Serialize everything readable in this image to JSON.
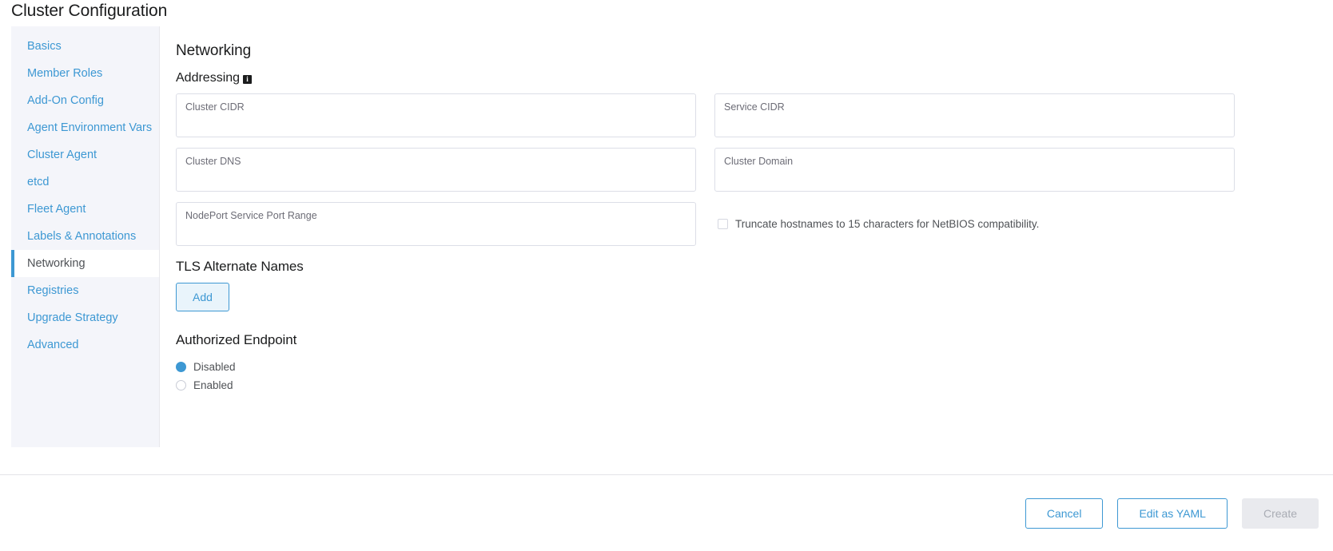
{
  "page_title": "Cluster Configuration",
  "sidebar": {
    "items": [
      {
        "label": "Basics",
        "active": false
      },
      {
        "label": "Member Roles",
        "active": false
      },
      {
        "label": "Add-On Config",
        "active": false
      },
      {
        "label": "Agent Environment Vars",
        "active": false
      },
      {
        "label": "Cluster Agent",
        "active": false
      },
      {
        "label": "etcd",
        "active": false
      },
      {
        "label": "Fleet Agent",
        "active": false
      },
      {
        "label": "Labels & Annotations",
        "active": false
      },
      {
        "label": "Networking",
        "active": true
      },
      {
        "label": "Registries",
        "active": false
      },
      {
        "label": "Upgrade Strategy",
        "active": false
      },
      {
        "label": "Advanced",
        "active": false
      }
    ]
  },
  "main": {
    "section_title": "Networking",
    "addressing": {
      "title": "Addressing",
      "info_icon": "info-icon",
      "info_glyph": "i",
      "fields": [
        {
          "label": "Cluster CIDR",
          "value": "",
          "placeholder": ""
        },
        {
          "label": "Service CIDR",
          "value": "",
          "placeholder": ""
        },
        {
          "label": "Cluster DNS",
          "value": "",
          "placeholder": ""
        },
        {
          "label": "Cluster Domain",
          "value": "",
          "placeholder": ""
        },
        {
          "label": "NodePort Service Port Range",
          "value": "",
          "placeholder": ""
        }
      ],
      "truncate_checkbox": {
        "label": "Truncate hostnames to 15 characters for NetBIOS compatibility.",
        "checked": false
      }
    },
    "tls": {
      "title": "TLS Alternate Names",
      "add_label": "Add"
    },
    "authorized_endpoint": {
      "title": "Authorized Endpoint",
      "options": [
        {
          "label": "Disabled",
          "selected": true
        },
        {
          "label": "Enabled",
          "selected": false
        }
      ]
    }
  },
  "footer": {
    "cancel_label": "Cancel",
    "yaml_label": "Edit as YAML",
    "create_label": "Create",
    "create_disabled": true
  },
  "colors": {
    "accent": "#3d98d3",
    "sidebar_bg": "#f4f5fa",
    "text": "#1b1c1d",
    "muted": "#6c6c76",
    "border": "#dcdee7"
  }
}
